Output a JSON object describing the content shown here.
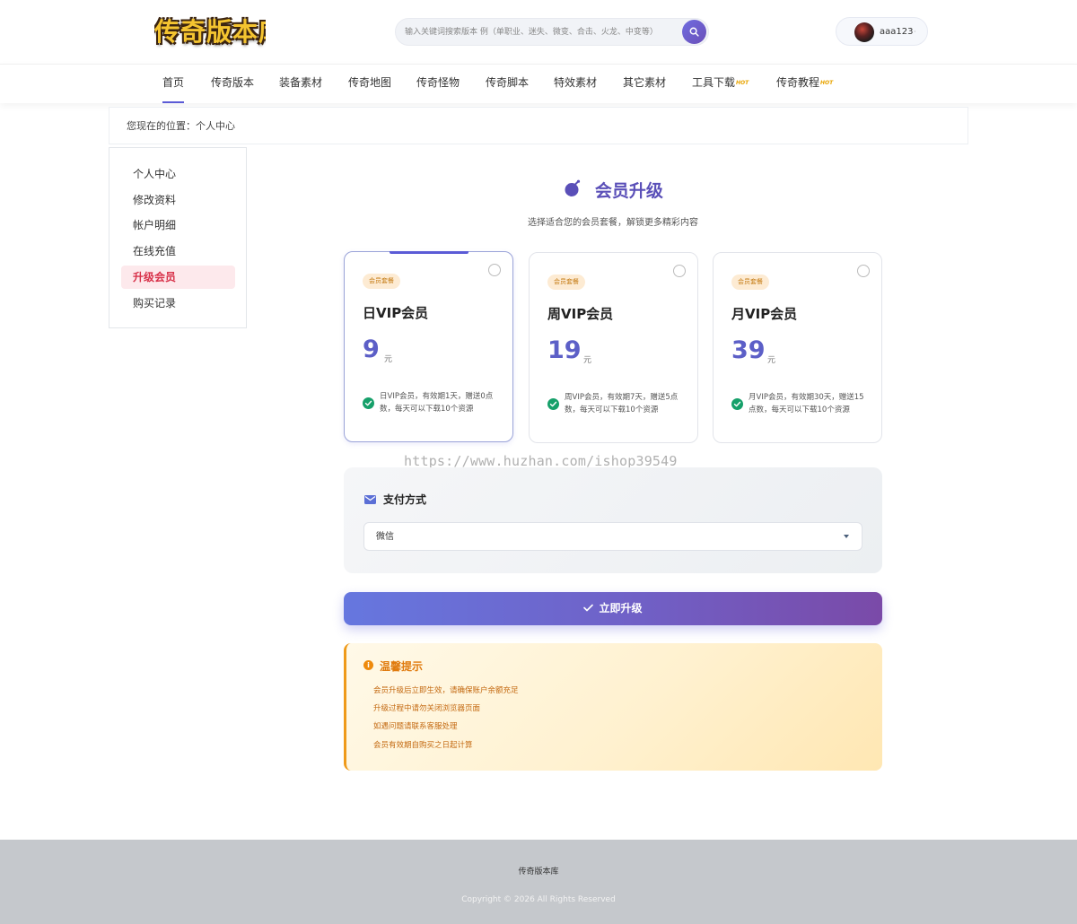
{
  "header": {
    "logo_text": "传奇版本库",
    "search_placeholder": "输入关键词搜索版本 例（单职业、迷失、微变、合击、火龙、中变等）",
    "username": "aaa123",
    "user_caret": "·"
  },
  "nav": {
    "items": [
      {
        "label": "首页",
        "active": true
      },
      {
        "label": "传奇版本"
      },
      {
        "label": "装备素材"
      },
      {
        "label": "传奇地图"
      },
      {
        "label": "传奇怪物"
      },
      {
        "label": "传奇脚本"
      },
      {
        "label": "特效素材"
      },
      {
        "label": "其它素材"
      },
      {
        "label": "工具下载",
        "hot": "HOT"
      },
      {
        "label": "传奇教程",
        "hot": "HOT"
      }
    ]
  },
  "breadcrumb": "您现在的位置：个人中心",
  "sidebar": {
    "items": [
      {
        "label": "个人中心"
      },
      {
        "label": "修改资料"
      },
      {
        "label": "帐户明细"
      },
      {
        "label": "在线充值"
      },
      {
        "label": "升级会员",
        "active": true
      },
      {
        "label": "购买记录"
      }
    ]
  },
  "main": {
    "title": "会员升级",
    "subtitle": "选择适合您的会员套餐，解锁更多精彩内容",
    "plans": [
      {
        "badge": "会员套餐",
        "name": "日VIP会员",
        "price": "9",
        "unit": "元",
        "desc": "日VIP会员，有效期1天，赠送0点数，每天可以下载10个资源",
        "selected": true
      },
      {
        "badge": "会员套餐",
        "name": "周VIP会员",
        "price": "19",
        "unit": "元",
        "desc": "周VIP会员，有效期7天，赠送5点数，每天可以下载10个资源"
      },
      {
        "badge": "会员套餐",
        "name": "月VIP会员",
        "price": "39",
        "unit": "元",
        "desc": "月VIP会员，有效期30天，赠送15点数，每天可以下载10个资源"
      }
    ],
    "watermark": "https://www.huzhan.com/ishop39549",
    "payment": {
      "title": "支付方式",
      "selected": "微信"
    },
    "upgrade_button": "立即升级",
    "tips": {
      "title": "温馨提示",
      "items": [
        "会员升级后立即生效，请确保账户余额充足",
        "升级过程中请勿关闭浏览器页面",
        "如遇问题请联系客服处理",
        "会员有效期自购买之日起计算"
      ]
    }
  },
  "footer": {
    "name": "传奇版本库",
    "copyright": "Copyright © 2026 All Rights Reserved"
  },
  "colors": {
    "accent": "#5b5bd6",
    "active_side": "#d8324a",
    "tip_text": "#c46a12",
    "check": "#16a06a"
  }
}
